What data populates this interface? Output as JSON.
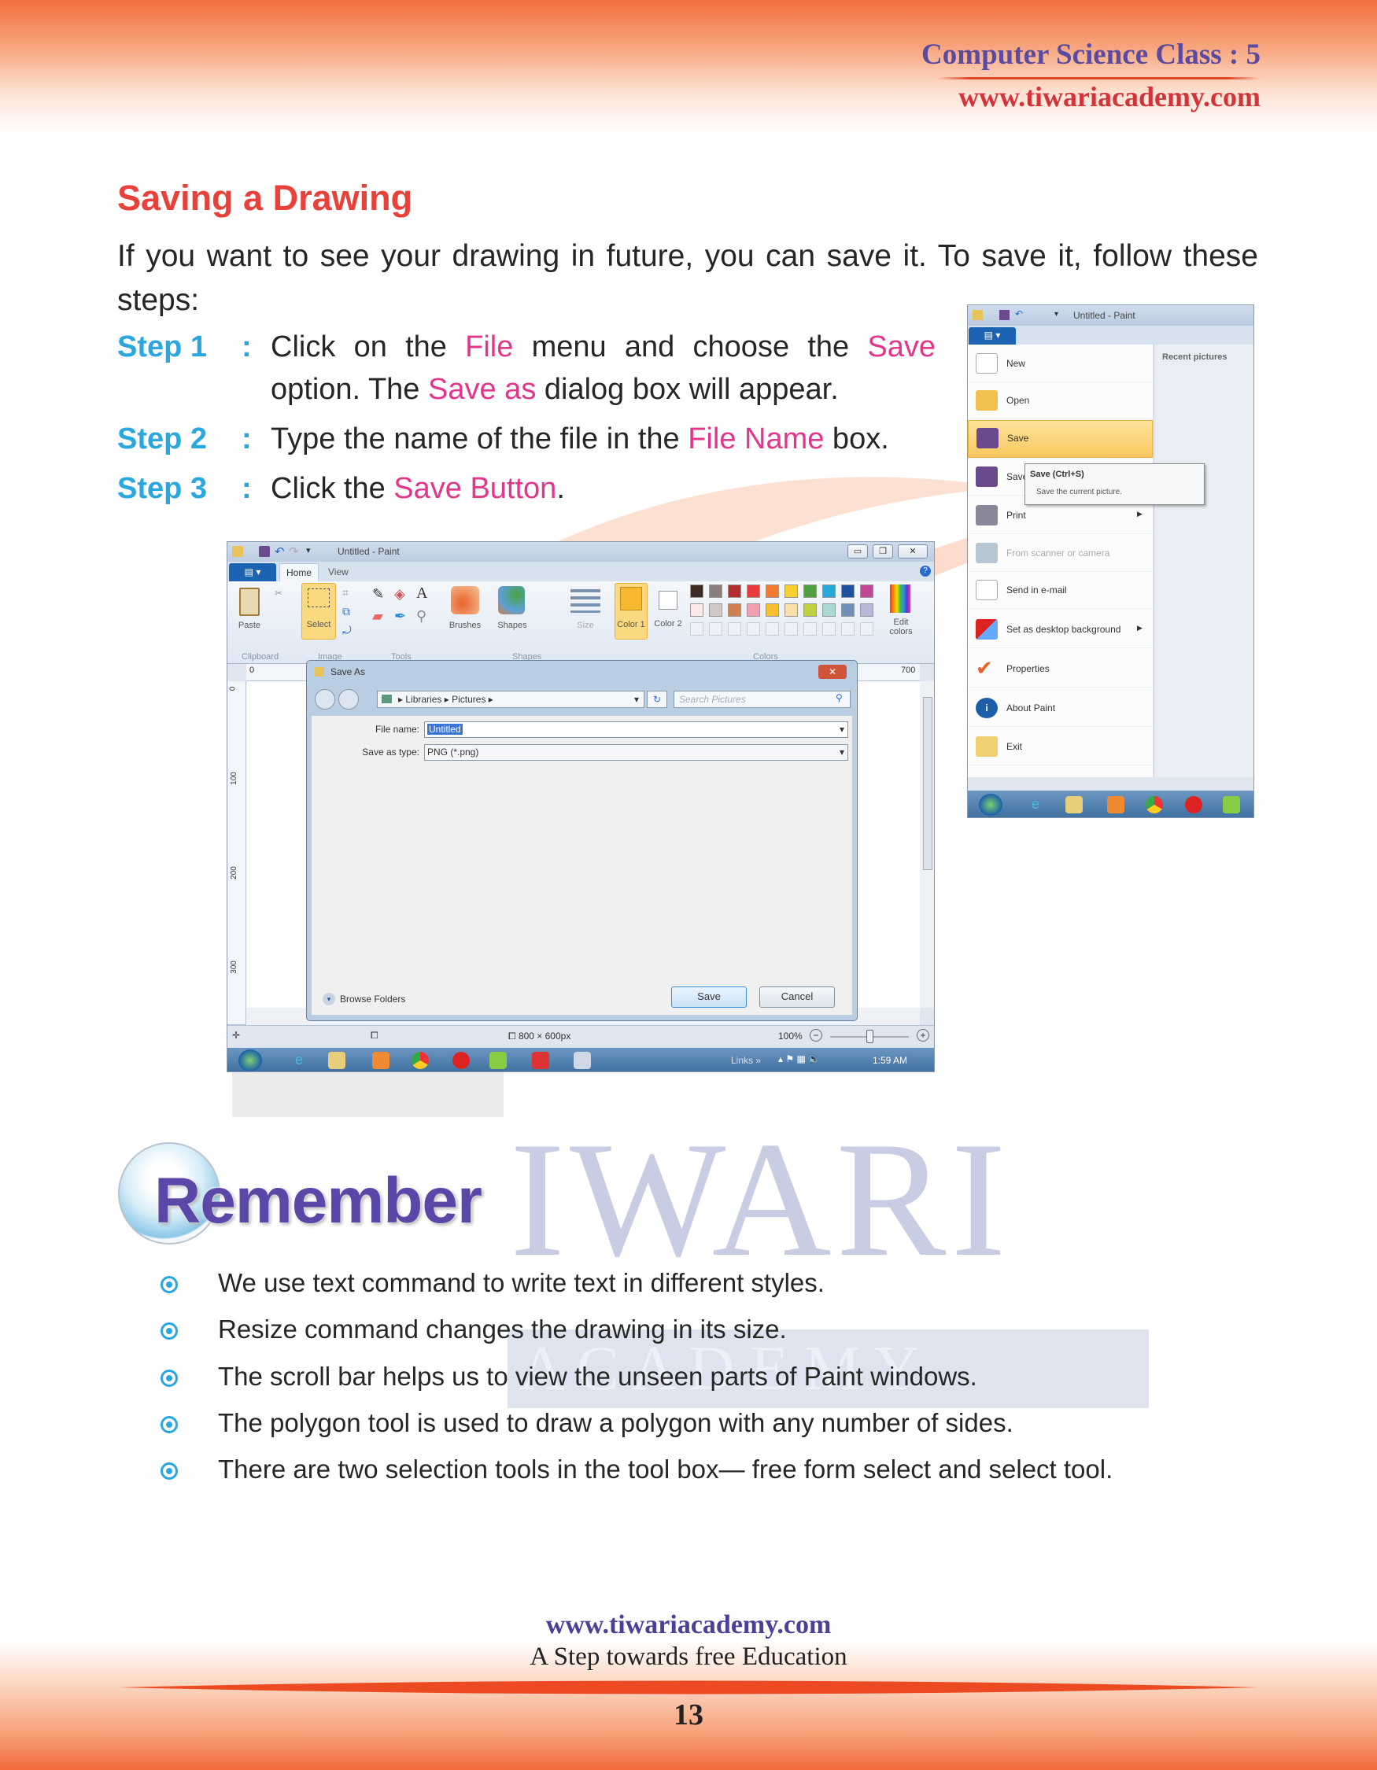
{
  "header": {
    "title": "Computer Science Class : 5",
    "url": "www.tiwariacademy.com"
  },
  "section": {
    "title": "Saving a Drawing",
    "intro": "If you want to see your drawing in future, you can save it. To save it, follow these steps:",
    "steps": [
      {
        "label": "Step 1",
        "colon": ":",
        "segments": [
          {
            "text": "Click on the "
          },
          {
            "text": "File",
            "highlight": true
          },
          {
            "text": " menu and choose the "
          },
          {
            "text": "Save",
            "highlight": true
          },
          {
            "text": " option. The "
          },
          {
            "text": "Save as",
            "highlight": true
          },
          {
            "text": " dialog box will appear."
          }
        ]
      },
      {
        "label": "Step 2",
        "colon": ":",
        "segments": [
          {
            "text": "Type the name of the file in the "
          },
          {
            "text": "File Name",
            "highlight": true
          },
          {
            "text": " box."
          }
        ]
      },
      {
        "label": "Step 3",
        "colon": ":",
        "segments": [
          {
            "text": "Click the "
          },
          {
            "text": "Save Button",
            "highlight": true
          },
          {
            "text": "."
          }
        ]
      }
    ]
  },
  "paint": {
    "window_title": "Untitled - Paint",
    "tabs": [
      "Home",
      "View"
    ],
    "ribbon": {
      "paste": "Paste",
      "select": "Select",
      "brushes": "Brushes",
      "shapes": "Shapes",
      "size": "Size",
      "color1": "Color 1",
      "color2": "Color 2",
      "edit_colors": "Edit colors",
      "groups": [
        "Clipboard",
        "Image",
        "Tools",
        "Shapes",
        "Colors"
      ]
    },
    "palette": [
      "#3a2a22",
      "#8a7f7a",
      "#b03030",
      "#e83a3a",
      "#f07a30",
      "#f8d030",
      "#50a040",
      "#28a8d8",
      "#2050a0",
      "#c04890",
      "#fde8e8",
      "#d0c8c4",
      "#d08050",
      "#f0a0b0",
      "#f8c030",
      "#f8e0a8",
      "#c0d040",
      "#a8d8d0",
      "#7090b8",
      "#b8b8d8"
    ],
    "color1": "#f5b82e",
    "ruler": {
      "start": "0",
      "end": "700",
      "v": [
        "0",
        "100",
        "200",
        "300"
      ]
    },
    "save_as": {
      "title": "Save As",
      "breadcrumb": [
        "Libraries",
        "Pictures"
      ],
      "search_placeholder": "Search Pictures",
      "file_name_label": "File name:",
      "file_name_value": "Untitled",
      "type_label": "Save as type:",
      "type_value": "PNG (*.png)",
      "browse": "Browse Folders",
      "save": "Save",
      "cancel": "Cancel"
    },
    "status": {
      "size": "800 × 600px",
      "zoom": "100%",
      "zoom_level": 100
    },
    "taskbar": {
      "links": "Links »",
      "time": "1:59 AM"
    }
  },
  "file_menu": {
    "window_title": "Untitled - Paint",
    "recent": "Recent pictures",
    "items": [
      "New",
      "Open",
      "Save",
      "Save as",
      "Print",
      "From scanner or camera",
      "Send in e-mail",
      "Set as desktop background",
      "Properties",
      "About Paint",
      "Exit"
    ],
    "tooltip": {
      "title": "Save (Ctrl+S)",
      "desc": "Save the current picture."
    }
  },
  "remember": {
    "title": "Remember",
    "items": [
      "We use text command to write text in different styles.",
      "Resize command changes the drawing in its size.",
      "The scroll bar helps us to view the unseen parts of Paint windows.",
      "The polygon tool is used to draw a polygon with any number of sides.",
      "There are two selection tools in the tool box— free form select and select tool."
    ]
  },
  "watermark": {
    "line1": "IWARI",
    "line2": "A C A D E M Y"
  },
  "footer": {
    "url": "www.tiwariacademy.com",
    "tagline": "A Step towards free Education",
    "page": "13"
  },
  "colors": {
    "heading": "#e8413a",
    "step": "#2aa7df",
    "highlight": "#e2368a",
    "header_purple": "#5a4aa0",
    "header_red": "#d2343a"
  }
}
